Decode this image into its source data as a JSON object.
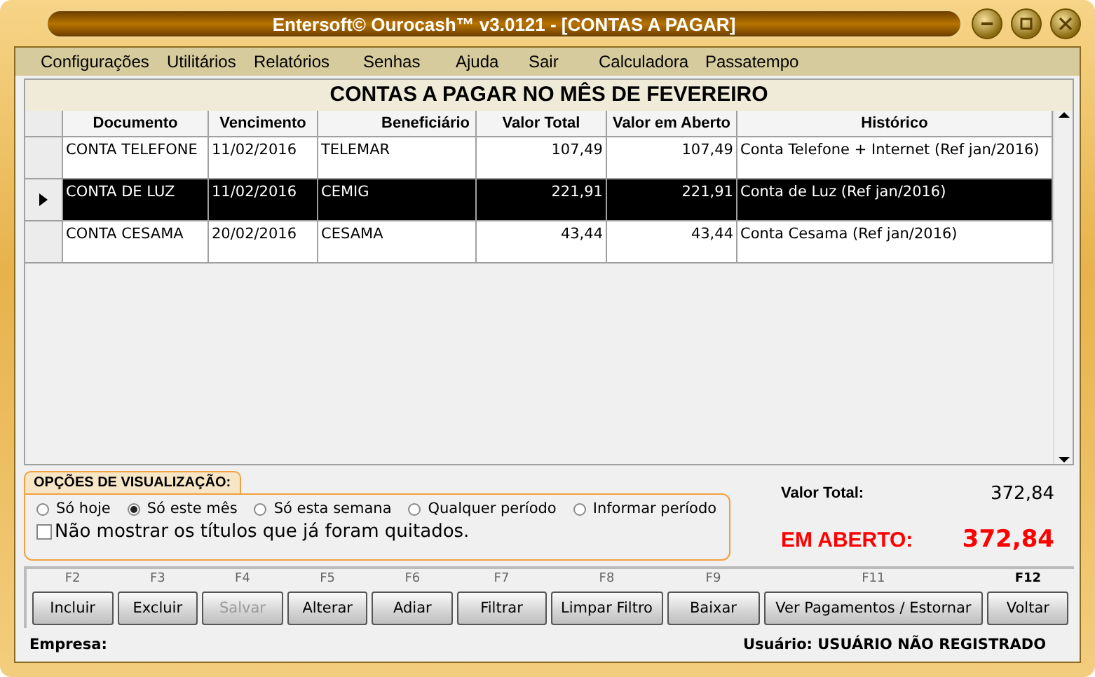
{
  "window": {
    "title": "Entersoft© Ourocash™ v3.0121 - [CONTAS A PAGAR]"
  },
  "menu": [
    "Configurações",
    "Utilitários",
    "Relatórios",
    "Senhas",
    "Ajuda",
    "Sair",
    "Calculadora",
    "Passatempo"
  ],
  "grid": {
    "title": "CONTAS A PAGAR NO MÊS DE FEVEREIRO",
    "columns": [
      "Documento",
      "Vencimento",
      "Beneficiário",
      "Valor Total",
      "Valor em Aberto",
      "Histórico"
    ],
    "rows": [
      {
        "selected": false,
        "cells": [
          "CONTA TELEFONE",
          "11/02/2016",
          "TELEMAR",
          "107,49",
          "107,49",
          "Conta Telefone + Internet (Ref jan/2016)"
        ]
      },
      {
        "selected": true,
        "cells": [
          "CONTA DE LUZ",
          "11/02/2016",
          "CEMIG",
          "221,91",
          "221,91",
          "Conta de Luz (Ref jan/2016)"
        ]
      },
      {
        "selected": false,
        "cells": [
          "CONTA CESAMA",
          "20/02/2016",
          "CESAMA",
          "43,44",
          "43,44",
          "Conta Cesama (Ref jan/2016)"
        ]
      }
    ]
  },
  "options": {
    "title": "OPÇÕES DE VISUALIZAÇÃO:",
    "radios": [
      {
        "label": "Só hoje",
        "selected": false
      },
      {
        "label": "Só este mês",
        "selected": true
      },
      {
        "label": "Só esta semana",
        "selected": false
      },
      {
        "label": "Qualquer período",
        "selected": false
      },
      {
        "label": "Informar período",
        "selected": false
      }
    ],
    "checkbox": {
      "label": "Não mostrar os títulos que já foram quitados.",
      "checked": false
    }
  },
  "totals": {
    "total_label": "Valor Total:",
    "total_value": "372,84",
    "open_label": "EM ABERTO:",
    "open_value": "372,84"
  },
  "buttons": [
    {
      "key": "F2",
      "label": "Incluir",
      "disabled": false,
      "default": false
    },
    {
      "key": "F3",
      "label": "Excluir",
      "disabled": false,
      "default": false
    },
    {
      "key": "F4",
      "label": "Salvar",
      "disabled": true,
      "default": false
    },
    {
      "key": "F5",
      "label": "Alterar",
      "disabled": false,
      "default": false
    },
    {
      "key": "F6",
      "label": "Adiar",
      "disabled": false,
      "default": false
    },
    {
      "key": "F7",
      "label": "Filtrar",
      "disabled": false,
      "default": false
    },
    {
      "key": "F8",
      "label": "Limpar Filtro",
      "disabled": false,
      "default": false
    },
    {
      "key": "F9",
      "label": "Baixar",
      "disabled": false,
      "default": false
    },
    {
      "key": "F11",
      "label": "Ver Pagamentos / Estornar",
      "disabled": false,
      "default": false
    },
    {
      "key": "F12",
      "label": "Voltar",
      "disabled": false,
      "default": true
    }
  ],
  "status_bar": {
    "company": "Empresa:",
    "user": "Usuário: USUÁRIO NÃO REGISTRADO"
  }
}
